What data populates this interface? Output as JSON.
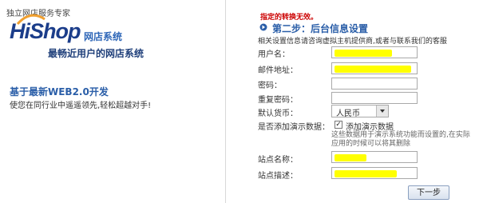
{
  "left": {
    "tagline": "独立网店服务专家",
    "logo": "HiShop",
    "logo_sub": "网店系统",
    "slogan": "最畅近用户的网店系统",
    "web20_title": "基于最新WEB2.0开发",
    "web20_desc": "使您在同行业中遥遥领先,轻松超越对手!"
  },
  "form": {
    "warning": "指定的转换无效。",
    "step_title": "第二步：后台信息设置",
    "intro": "相关设置信息请咨询虚拟主机提供商,或者与联系我们的客服",
    "username_label": "用户名：",
    "email_label": "邮件地址：",
    "password_label": "密码：",
    "confirm_password_label": "重复密码：",
    "currency_label": "默认货币：",
    "currency_value": "人民币",
    "demo_label": "是否添加演示数据：",
    "demo_checkbox_label": "添加演示数据",
    "demo_checked": true,
    "demo_hint": "这些数据用于演示系统功能而设置的,在实际应用的时候可以将其删除",
    "site_name_label": "站点名称：",
    "site_desc_label": "站点描述：",
    "next_button": "下一步"
  },
  "colors": {
    "brand_blue": "#1b3d8a",
    "accent_blue": "#2a5ea8",
    "warning_red": "#cc0000",
    "highlight": "#ffff00"
  }
}
